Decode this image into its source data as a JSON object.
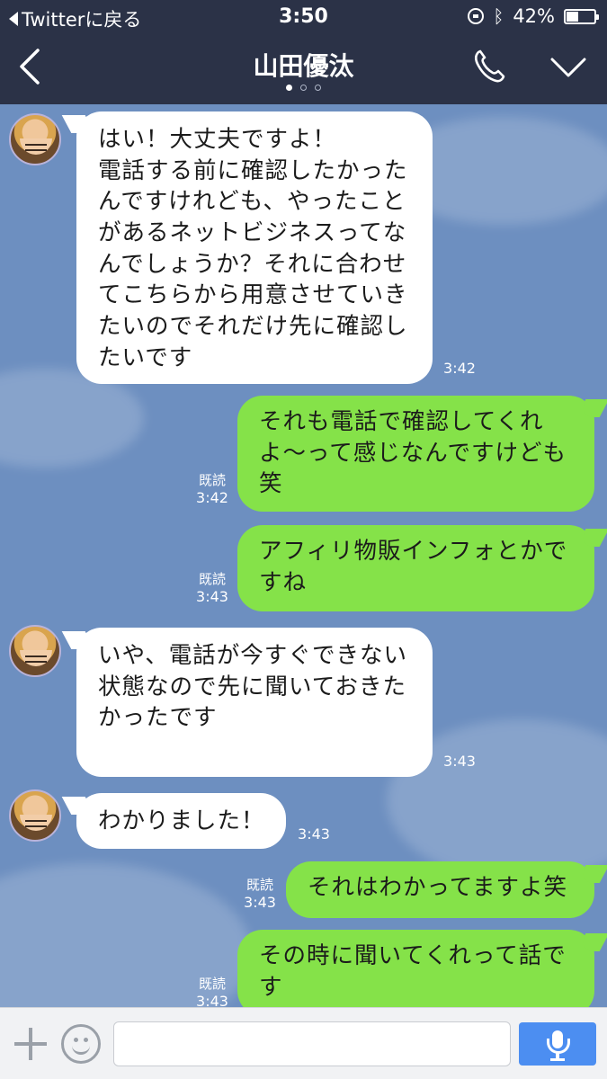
{
  "status_bar": {
    "back_app_label": "Twitterに戻る",
    "time": "3:50",
    "battery_percent": "42%",
    "battery_level": 0.42
  },
  "nav": {
    "title": "山田優汰",
    "page_dots": 3,
    "active_dot": 0
  },
  "messages": [
    {
      "side": "in",
      "text": "はい！大丈夫ですよ！\n電話する前に確認したかったんですけれども、やったことがあるネットビジネスってなんでしょうか？それに合わせてこちらから用意させていきたいのでそれだけ先に確認したいです",
      "time": "3:42"
    },
    {
      "side": "out",
      "text": "それも電話で確認してくれよ〜って感じなんですけども笑",
      "read": "既読",
      "time": "3:42"
    },
    {
      "side": "out",
      "text": "アフィリ物販インフォとかですね",
      "read": "既読",
      "time": "3:43"
    },
    {
      "side": "in",
      "text": "いや、電話が今すぐできない状態なので先に聞いておきたかったです",
      "time": "3:43"
    },
    {
      "side": "in",
      "text": "わかりました！",
      "time": "3:43"
    },
    {
      "side": "out",
      "text": "それはわかってますよ笑",
      "read": "既読",
      "time": "3:43"
    },
    {
      "side": "out",
      "text": "その時に聞いてくれって話です",
      "read": "既読",
      "time": "3:43"
    }
  ],
  "input": {
    "value": "",
    "placeholder": ""
  },
  "icons": {
    "back": "chevron-left-icon",
    "call": "phone-icon",
    "menu": "chevron-down-icon",
    "add": "plus-icon",
    "sticker": "emoji-icon",
    "voice": "microphone-icon"
  },
  "colors": {
    "header_bg": "#2b3247",
    "chat_bg": "#6d8fc0",
    "incoming_bubble": "#ffffff",
    "outgoing_bubble": "#85e249",
    "send_button": "#4c8ef1"
  }
}
